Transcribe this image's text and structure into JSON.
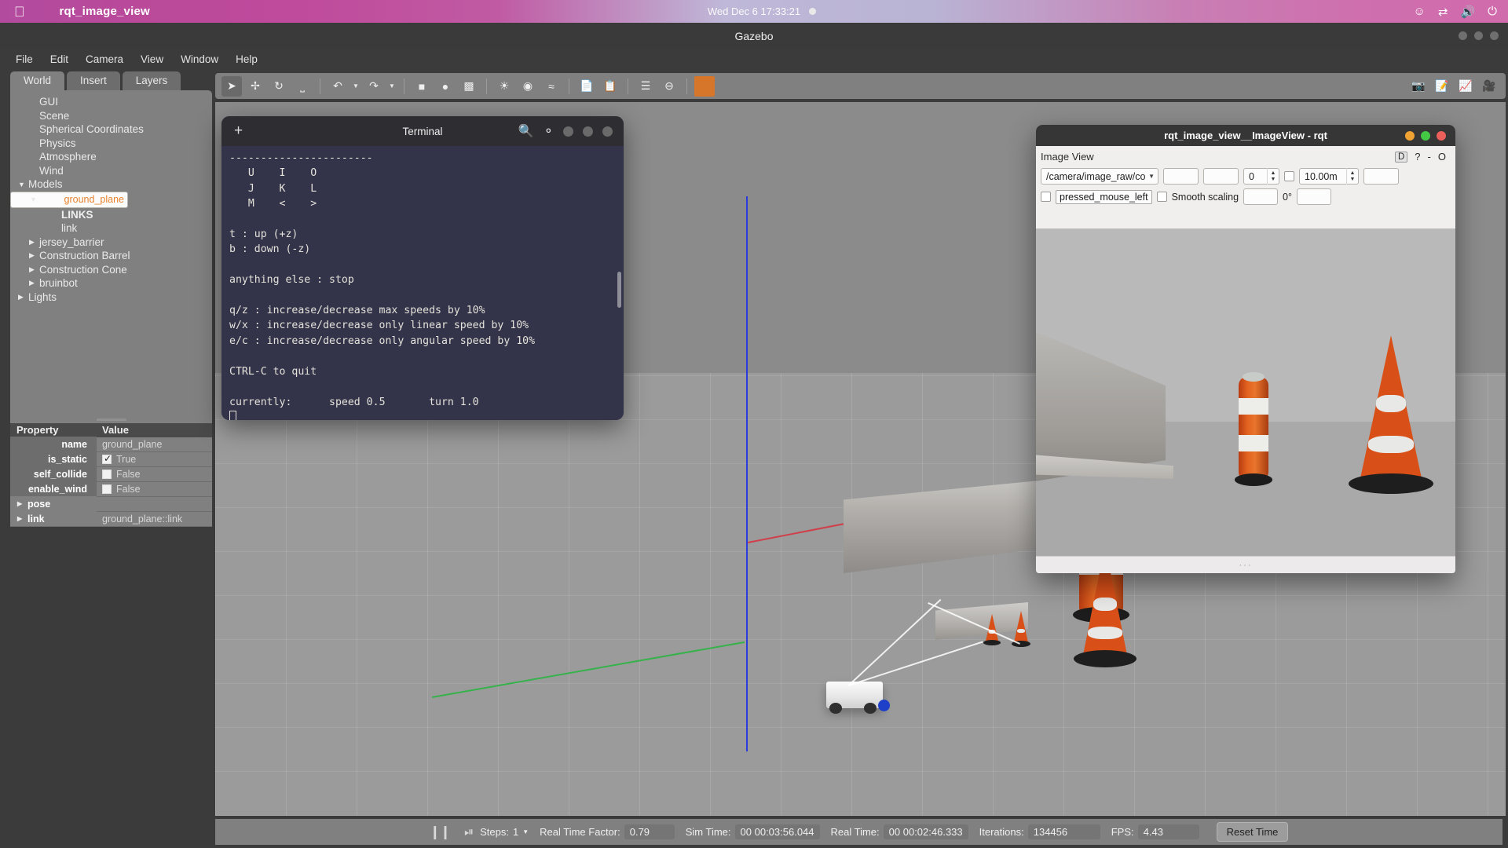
{
  "desktop": {
    "app_name": "rqt_image_view",
    "clock": "Wed Dec 6  17:33:21",
    "tray": [
      "emoji-icon",
      "network-icon",
      "volume-icon",
      "power-icon"
    ]
  },
  "gazebo": {
    "window_title": "Gazebo",
    "menu": [
      "File",
      "Edit",
      "Camera",
      "View",
      "Window",
      "Help"
    ],
    "tabs": [
      {
        "label": "World",
        "active": true
      },
      {
        "label": "Insert",
        "active": false
      },
      {
        "label": "Layers",
        "active": false
      }
    ],
    "tree": [
      {
        "label": "GUI",
        "indent": 1,
        "arrow": "none",
        "selected": false,
        "bold": false
      },
      {
        "label": "Scene",
        "indent": 1,
        "arrow": "none",
        "selected": false,
        "bold": false
      },
      {
        "label": "Spherical Coordinates",
        "indent": 1,
        "arrow": "none",
        "selected": false,
        "bold": false
      },
      {
        "label": "Physics",
        "indent": 1,
        "arrow": "none",
        "selected": false,
        "bold": false
      },
      {
        "label": "Atmosphere",
        "indent": 1,
        "arrow": "none",
        "selected": false,
        "bold": false
      },
      {
        "label": "Wind",
        "indent": 1,
        "arrow": "none",
        "selected": false,
        "bold": false
      },
      {
        "label": "Models",
        "indent": 0,
        "arrow": "down",
        "selected": false,
        "bold": false
      },
      {
        "label": "ground_plane",
        "indent": 1,
        "arrow": "down",
        "selected": true,
        "bold": false
      },
      {
        "label": "LINKS",
        "indent": 3,
        "arrow": "none",
        "selected": false,
        "bold": true
      },
      {
        "label": "link",
        "indent": 3,
        "arrow": "none",
        "selected": false,
        "bold": false
      },
      {
        "label": "jersey_barrier",
        "indent": 1,
        "arrow": "right",
        "selected": false,
        "bold": false
      },
      {
        "label": "Construction Barrel",
        "indent": 1,
        "arrow": "right",
        "selected": false,
        "bold": false
      },
      {
        "label": "Construction Cone",
        "indent": 1,
        "arrow": "right",
        "selected": false,
        "bold": false
      },
      {
        "label": "bruinbot",
        "indent": 1,
        "arrow": "right",
        "selected": false,
        "bold": false
      },
      {
        "label": "Lights",
        "indent": 0,
        "arrow": "right",
        "selected": false,
        "bold": false
      }
    ],
    "property_table": {
      "headers": [
        "Property",
        "Value"
      ],
      "rows": [
        {
          "property": "name",
          "value": "ground_plane",
          "type": "text",
          "expandable": false
        },
        {
          "property": "is_static",
          "value": "True",
          "type": "checkbox",
          "checked": true,
          "expandable": false
        },
        {
          "property": "self_collide",
          "value": "False",
          "type": "checkbox",
          "checked": false,
          "expandable": false
        },
        {
          "property": "enable_wind",
          "value": "False",
          "type": "checkbox",
          "checked": false,
          "expandable": false
        },
        {
          "property": "pose",
          "value": "",
          "type": "text",
          "expandable": true
        },
        {
          "property": "link",
          "value": "ground_plane::link",
          "type": "text",
          "expandable": true
        }
      ]
    },
    "toolbar_icons": [
      "select-arrow-icon",
      "translate-icon",
      "rotate-icon",
      "scale-icon",
      "undo-icon",
      "undo-dropdown-icon",
      "redo-icon",
      "redo-dropdown-icon",
      "box-icon",
      "sphere-icon",
      "cylinder-icon",
      "point-light-icon",
      "spot-light-icon",
      "directional-light-icon",
      "copy-icon",
      "paste-icon",
      "align-icon",
      "snap-icon",
      "color-swatch-icon"
    ],
    "toolbar_right_icons": [
      "screenshot-icon",
      "log-icon",
      "plot-icon",
      "video-icon"
    ],
    "status_bar": {
      "pause_icon": "pause-icon",
      "step_icon": "step-forward-icon",
      "steps_label": "Steps:",
      "steps_value": "1",
      "real_time_factor_label": "Real Time Factor:",
      "real_time_factor_value": "0.79",
      "sim_time_label": "Sim Time:",
      "sim_time_value": "00 00:03:56.044",
      "real_time_label": "Real Time:",
      "real_time_value": "00 00:02:46.333",
      "iterations_label": "Iterations:",
      "iterations_value": "134456",
      "fps_label": "FPS:",
      "fps_value": "4.43",
      "reset_button": "Reset Time"
    }
  },
  "terminal": {
    "title": "Terminal",
    "new_tab_icon": "plus-icon",
    "search_icon": "search-icon",
    "menu_icon": "hamburger-dots-icon",
    "content": "-----------------------\n   U    I    O\n   J    K    L\n   M    <    >\n\nt : up (+z)\nb : down (-z)\n\nanything else : stop\n\nq/z : increase/decrease max speeds by 10%\nw/x : increase/decrease only linear speed by 10%\ne/c : increase/decrease only angular speed by 10%\n\nCTRL-C to quit\n\ncurrently:\tspeed 0.5\tturn 1.0\n"
  },
  "rqt": {
    "window_title": "rqt_image_view__ImageView - rqt",
    "plugin_title": "Image View",
    "dock_buttons": [
      "D",
      "?",
      "-",
      "O"
    ],
    "topic_value": "/camera/image_raw/co",
    "empty_field_1": "",
    "empty_field_2": "",
    "num_value": "0",
    "range_checkbox_checked": false,
    "range_value": "10.00m",
    "empty_field_3": "",
    "mouse_checkbox_checked": false,
    "mouse_label": "pressed_mouse_left",
    "smooth_checkbox_checked": false,
    "smooth_label": "Smooth scaling",
    "empty_field_4": "",
    "rotation_label": "0°",
    "empty_field_5": "",
    "grip_label": "···"
  },
  "colors": {
    "accent_orange": "#e8832e",
    "gazebo_panel": "#808080",
    "gazebo_chrome": "#3b3b3b",
    "terminal_bg": "#33344a",
    "rqt_bg": "#f0efee",
    "close_red": "#ec5f5a",
    "min_yellow": "#f0a232",
    "max_green": "#44c944",
    "axis_x": "#d0404a",
    "axis_y": "#35b24a",
    "axis_z": "#2a3bdd"
  }
}
